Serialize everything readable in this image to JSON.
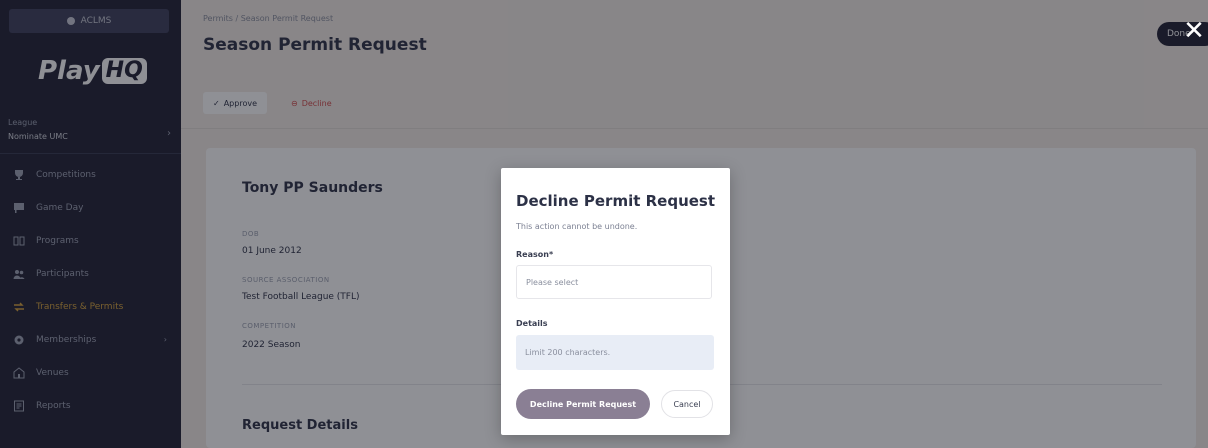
{
  "account": {
    "label": "ACLMS"
  },
  "brand": {
    "logo_text": "Play",
    "logo_badge": "HQ"
  },
  "league": {
    "label": "League",
    "name": "Nominate UMC"
  },
  "nav": {
    "items": [
      {
        "label": "Competitions",
        "icon": "trophy-icon",
        "active": false
      },
      {
        "label": "Game Day",
        "icon": "flag-icon",
        "active": false
      },
      {
        "label": "Programs",
        "icon": "book-icon",
        "active": false
      },
      {
        "label": "Participants",
        "icon": "people-icon",
        "active": false
      },
      {
        "label": "Transfers & Permits",
        "icon": "transfer-icon",
        "active": true
      },
      {
        "label": "Memberships",
        "icon": "gear-icon",
        "active": false,
        "has_chevron": true
      },
      {
        "label": "Venues",
        "icon": "venue-icon",
        "active": false
      },
      {
        "label": "Reports",
        "icon": "report-icon",
        "active": false
      }
    ]
  },
  "header": {
    "breadcrumb": "Permits / Season Permit Request",
    "title": "Season Permit Request",
    "top_right_button": "Done",
    "approve_label": "Approve",
    "decline_label": "Decline"
  },
  "card": {
    "person_name": "Tony PP Saunders",
    "fields": [
      {
        "label": "DOB",
        "value": "01 June 2012"
      },
      {
        "label": "SOURCE ASSOCIATION",
        "value": "Test Football League (TFL)"
      },
      {
        "label": "COMPETITION",
        "value": "2022 Season"
      }
    ],
    "section_title": "Request Details"
  },
  "modal": {
    "title": "Decline Permit Request",
    "subtitle": "This action cannot be undone.",
    "reason_label": "Reason*",
    "reason_placeholder": "Please select",
    "details_label": "Details",
    "details_placeholder": "Limit 200 characters.",
    "confirm_label": "Decline Permit Request",
    "cancel_label": "Cancel"
  },
  "colors": {
    "sidebar_bg": "#1f1f33",
    "active_nav": "#d6a33b",
    "confirm_button": "#8a7f94",
    "decline_text": "#d24a4a"
  }
}
